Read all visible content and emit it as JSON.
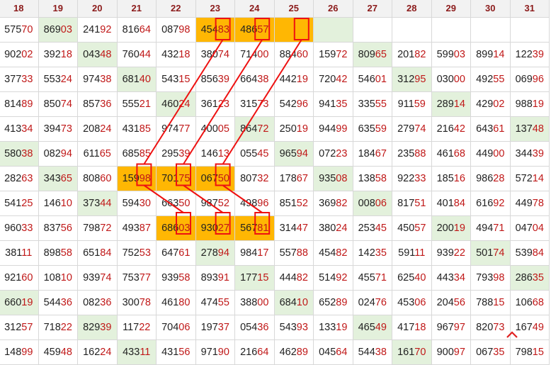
{
  "columns": [
    "18",
    "19",
    "20",
    "21",
    "22",
    "23",
    "24",
    "25",
    "26",
    "27",
    "28",
    "29",
    "30",
    "31"
  ],
  "rows": [
    [
      "57570",
      "86903",
      "24192",
      "81664",
      "08798",
      "45483",
      "48657",
      "",
      "",
      "",
      "",
      "",
      "",
      ""
    ],
    [
      "90202",
      "39218",
      "04348",
      "76044",
      "43218",
      "38074",
      "71400",
      "88460",
      "15972",
      "80965",
      "20182",
      "59903",
      "89914",
      "12239"
    ],
    [
      "37733",
      "55324",
      "97438",
      "68140",
      "54315",
      "85639",
      "66438",
      "44219",
      "72042",
      "54601",
      "31295",
      "03000",
      "49255",
      "06996"
    ],
    [
      "81489",
      "85074",
      "85736",
      "55521",
      "46024",
      "36123",
      "31573",
      "54296",
      "94135",
      "33555",
      "91159",
      "28914",
      "42902",
      "98819"
    ],
    [
      "41334",
      "39473",
      "20824",
      "43185",
      "97477",
      "40005",
      "86472",
      "25019",
      "94499",
      "63559",
      "27974",
      "21642",
      "64361",
      "13748"
    ],
    [
      "58038",
      "08294",
      "61165",
      "68585",
      "29539",
      "14613",
      "05545",
      "96594",
      "07223",
      "18467",
      "23588",
      "46168",
      "44900",
      "34439"
    ],
    [
      "28263",
      "34365",
      "80860",
      "15998",
      "70175",
      "06750",
      "80732",
      "17867",
      "93508",
      "13858",
      "92233",
      "18516",
      "98628",
      "57214"
    ],
    [
      "54125",
      "14610",
      "37344",
      "59430",
      "66350",
      "98752",
      "49896",
      "85152",
      "36982",
      "00806",
      "81751",
      "40184",
      "61692",
      "44978"
    ],
    [
      "96033",
      "83756",
      "79872",
      "49387",
      "68603",
      "93027",
      "56781",
      "31447",
      "38024",
      "25345",
      "45057",
      "20019",
      "49471",
      "04704"
    ],
    [
      "38111",
      "89858",
      "65184",
      "75253",
      "64761",
      "27894",
      "98417",
      "55788",
      "45482",
      "14235",
      "59111",
      "93922",
      "50174",
      "53984"
    ],
    [
      "92160",
      "10810",
      "93974",
      "75377",
      "93958",
      "89391",
      "17715",
      "44482",
      "51492",
      "45571",
      "62540",
      "44334",
      "79398",
      "28635"
    ],
    [
      "66019",
      "54436",
      "08236",
      "30078",
      "46180",
      "47455",
      "38800",
      "68410",
      "65289",
      "02476",
      "45306",
      "20456",
      "78815",
      "10668"
    ],
    [
      "31257",
      "71822",
      "82939",
      "11722",
      "70406",
      "19737",
      "05436",
      "54393",
      "13319",
      "46549",
      "41718",
      "96797",
      "82073",
      "16749"
    ],
    [
      "14899",
      "45948",
      "16224",
      "43311",
      "43156",
      "97190",
      "21664",
      "46289",
      "04564",
      "54438",
      "16170",
      "90097",
      "06735",
      "79815"
    ]
  ],
  "cell_fill": [
    "nggggggoo-g-----",
    "nnnnnnnnnnnnnn",
    "nnnnnnnnnnnnnn",
    "nnnnnnnnnnnnnn",
    "nnnnnnnnnnnnnn",
    "nnnnnnnnnnnnnn",
    "nnnnnnnnnnnnnn",
    "nnnnnnnnnnnnnn",
    "nnnnnnnnnnnnnn",
    "nnnnnnnnnnnnnn",
    "nnnnnnnnnnnnnn",
    "nnnnnnnnnnnnnn",
    "nnnnnnnnnnnnnn",
    "nnnnnnnnnnnnnn"
  ],
  "green_cells": [
    [
      0,
      1
    ],
    [
      0,
      8
    ],
    [
      1,
      2
    ],
    [
      1,
      9
    ],
    [
      2,
      3
    ],
    [
      2,
      10
    ],
    [
      3,
      4
    ],
    [
      3,
      11
    ],
    [
      4,
      6
    ],
    [
      4,
      13
    ],
    [
      5,
      0
    ],
    [
      5,
      7
    ],
    [
      6,
      1
    ],
    [
      6,
      8
    ],
    [
      7,
      2
    ],
    [
      7,
      9
    ],
    [
      8,
      11
    ],
    [
      9,
      5
    ],
    [
      9,
      12
    ],
    [
      10,
      6
    ],
    [
      10,
      13
    ],
    [
      11,
      0
    ],
    [
      11,
      7
    ],
    [
      12,
      2
    ],
    [
      12,
      9
    ],
    [
      13,
      3
    ],
    [
      13,
      10
    ]
  ],
  "orange_cells": [
    [
      0,
      5
    ],
    [
      0,
      6
    ],
    [
      0,
      7
    ],
    [
      6,
      3
    ],
    [
      6,
      4
    ],
    [
      6,
      5
    ],
    [
      8,
      4
    ],
    [
      8,
      5
    ],
    [
      8,
      6
    ]
  ],
  "empty_cells": [
    [
      0,
      8
    ],
    [
      0,
      9
    ],
    [
      0,
      10
    ],
    [
      0,
      11
    ],
    [
      0,
      12
    ],
    [
      0,
      13
    ]
  ],
  "colors": {
    "header_text": "#8b1a1a",
    "header_bg": "#f2f2f2",
    "green_cell": "#e3f1dc",
    "orange_cell": "#ffb703",
    "digit_red": "#c01818",
    "marker_line": "#ee1111"
  },
  "markers": {
    "boxes": [
      [
        0,
        5,
        4
      ],
      [
        0,
        6,
        4
      ],
      [
        0,
        7,
        4
      ],
      [
        6,
        3,
        4
      ],
      [
        6,
        4,
        4
      ],
      [
        6,
        5,
        4
      ],
      [
        8,
        4,
        4
      ],
      [
        8,
        5,
        4
      ],
      [
        8,
        6,
        4
      ]
    ],
    "lines": [
      [
        [
          0,
          5
        ],
        [
          6,
          3
        ]
      ],
      [
        [
          0,
          6
        ],
        [
          6,
          4
        ]
      ],
      [
        [
          0,
          7
        ],
        [
          6,
          5
        ]
      ],
      [
        [
          6,
          3
        ],
        [
          8,
          4
        ]
      ],
      [
        [
          6,
          4
        ],
        [
          8,
          5
        ]
      ],
      [
        [
          6,
          5
        ],
        [
          8,
          6
        ]
      ]
    ]
  },
  "scroll_top_icon": "chevron-up-icon"
}
